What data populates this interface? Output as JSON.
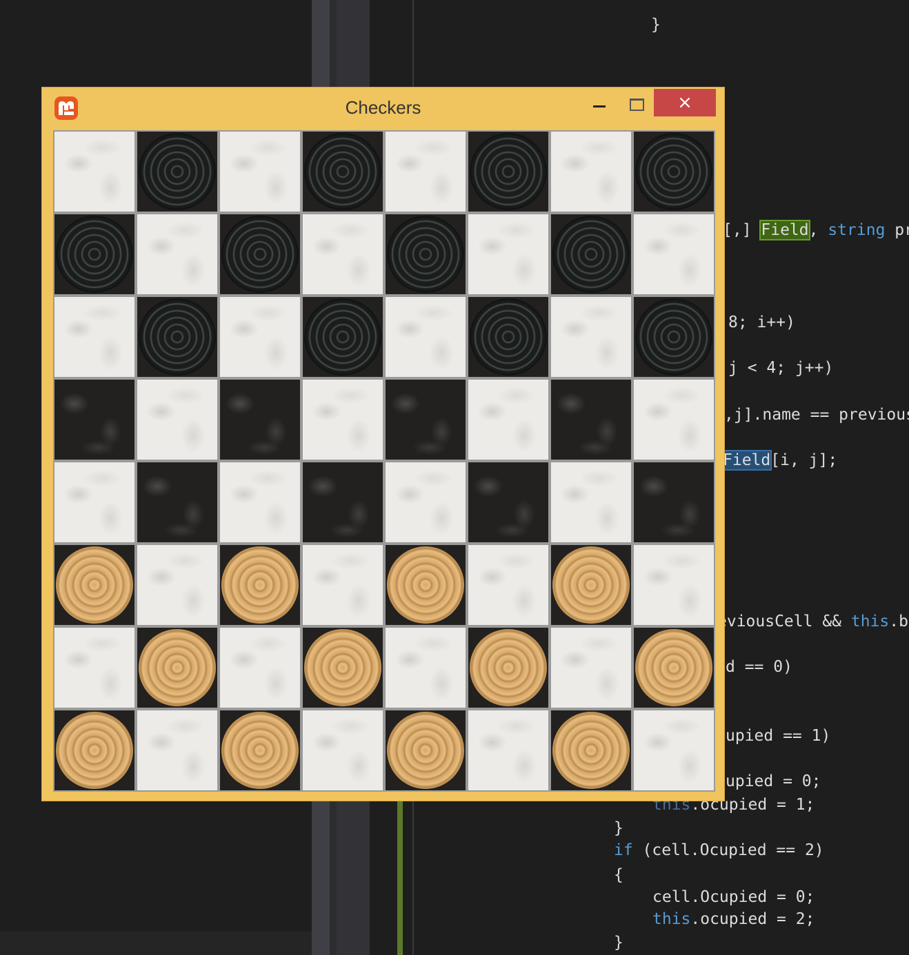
{
  "window": {
    "title": "Checkers",
    "close_glyph": "×",
    "icons": {
      "app": "monogame-icon",
      "minimize": "minimize-icon",
      "maximize": "maximize-icon",
      "close": "close-icon"
    }
  },
  "board": {
    "size": 8,
    "light_color": "#ecebe8",
    "dark_color": "#222120",
    "rows": [
      "lblblblb",
      "blblblbl",
      "lblblblb",
      "........",
      "........",
      "wlwlwlwl",
      "lwlwlwlw",
      "wlwlwlwl"
    ],
    "legend": {
      "b": "black piece",
      "w": "white piece",
      "l": "empty",
      ".": "empty"
    }
  },
  "code_editor": {
    "lines": [
      {
        "text": "}",
        "segments": [
          {
            "t": "}",
            "c": "plain"
          }
        ]
      },
      {
        "text": "[,] Field, string pr",
        "segments": [
          {
            "t": "[,] ",
            "c": "plain"
          },
          {
            "t": "Field",
            "c": "hl-green"
          },
          {
            "t": ", ",
            "c": "plain"
          },
          {
            "t": "string",
            "c": "kw"
          },
          {
            "t": " pr",
            "c": "plain"
          }
        ]
      },
      {
        "text": "8; i++)",
        "segments": [
          {
            "t": "8; i++)",
            "c": "plain"
          }
        ]
      },
      {
        "text": "j < 4; j++)",
        "segments": [
          {
            "t": "j < 4; j++)",
            "c": "plain"
          }
        ]
      },
      {
        "text": ",j].name == previous",
        "segments": [
          {
            "t": ",j].name == previous",
            "c": "plain"
          }
        ]
      },
      {
        "text": "Field[i, j];",
        "segments": [
          {
            "t": "Field",
            "c": "hl-blue"
          },
          {
            "t": "[i, j];",
            "c": "plain"
          }
        ]
      },
      {
        "text": "eviousCell && this.b",
        "segments": [
          {
            "t": "eviousCell && ",
            "c": "plain"
          },
          {
            "t": "this",
            "c": "kw"
          },
          {
            "t": ".b",
            "c": "plain"
          }
        ]
      },
      {
        "text": "d == 0)",
        "segments": [
          {
            "t": "d == 0)",
            "c": "plain"
          }
        ]
      },
      {
        "text": "upied == 1)",
        "segments": [
          {
            "t": "upied == 1)",
            "c": "plain"
          }
        ]
      },
      {
        "text": "upied = 0;",
        "segments": [
          {
            "t": "upied = 0;",
            "c": "plain"
          }
        ]
      },
      {
        "text": "this.ocupied = 1;",
        "segments": [
          {
            "t": "this",
            "c": "kw-dim"
          },
          {
            "t": ".ocupied = 1;",
            "c": "plain"
          }
        ]
      },
      {
        "text": "}",
        "segments": [
          {
            "t": "}",
            "c": "plain"
          }
        ]
      },
      {
        "text": "if (cell.Ocupied == 2)",
        "segments": [
          {
            "t": "if",
            "c": "kw"
          },
          {
            "t": " (cell.Ocupied == 2)",
            "c": "plain"
          }
        ]
      },
      {
        "text": "{",
        "segments": [
          {
            "t": "{",
            "c": "plain"
          }
        ]
      },
      {
        "text": "cell.Ocupied = 0;",
        "segments": [
          {
            "t": "cell.Ocupied = 0;",
            "c": "plain"
          }
        ]
      },
      {
        "text": "this.ocupied = 2;",
        "segments": [
          {
            "t": "this",
            "c": "kw"
          },
          {
            "t": ".ocupied = 2;",
            "c": "plain"
          }
        ]
      },
      {
        "text": "}",
        "segments": [
          {
            "t": "}",
            "c": "plain"
          }
        ]
      }
    ]
  }
}
